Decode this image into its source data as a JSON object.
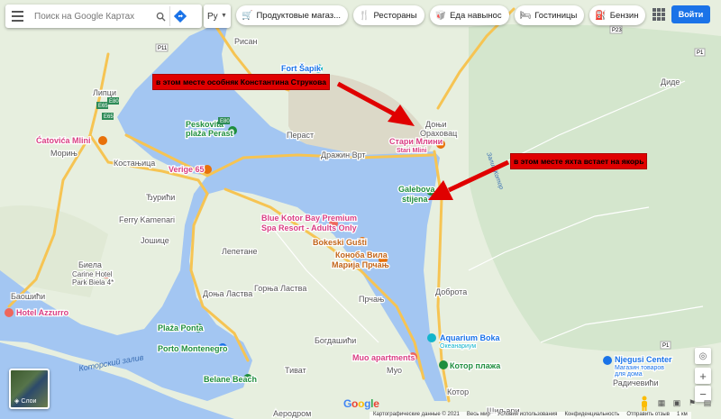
{
  "search": {
    "placeholder": "Поиск на Google Картах",
    "lang_value": "Ру"
  },
  "chips": [
    {
      "icon": "shopping-cart-icon",
      "label": "Продуктовые магаз..."
    },
    {
      "icon": "fork-knife-icon",
      "label": "Рестораны"
    },
    {
      "icon": "takeout-icon",
      "label": "Еда навынос"
    },
    {
      "icon": "bed-icon",
      "label": "Гостиницы"
    },
    {
      "icon": "fuel-pump-icon",
      "label": "Бензин"
    }
  ],
  "header": {
    "signin_label": "Войти"
  },
  "annotations": [
    "в этом месте особняк Константина Струкова",
    "в этом месте яхта встает на якорь"
  ],
  "places": {
    "risan": "Рисан",
    "lipci": "Липци",
    "morinj": "Морињ",
    "kostanjica": "Костањица",
    "djuricici": "Ђурићи",
    "ferry": "Ferry Kamenari",
    "josice": "Јошице",
    "bijela": "Биела",
    "baosici": "Баошићи",
    "perast": "Пераст",
    "dražin": "Дражин Врт",
    "donji": "Доњи",
    "orahovac": "Ораховац",
    "lepetane": "Лепетане",
    "donja_lastva": "Доња Ластва",
    "gornja_lastva": "Горња Ластва",
    "prcanj": "Прчањ",
    "bogdasici": "Богдашићи",
    "tivat": "Тиват",
    "muo": "Муо",
    "dobrota": "Доброта",
    "kotor": "Котор",
    "dide": "Диде",
    "sirokoca": "Шиљари",
    "radicevici": "Радичевићи",
    "aerodrom": "Аеродром",
    "bay": "Которский залив",
    "zaliv": "Залив Котор"
  },
  "pois": {
    "fort": "Fort Šapik",
    "peskovita": "Peskovita\nplaža Perast",
    "catovica": "Ćatovića Mlini",
    "verige": "Verige 65",
    "blue_kotor": "Blue Kotor Bay Premium\nSpa Resort - Adults Only",
    "bokeski": "Bokeski Gušti",
    "konoba": "Конoба Вила\nМарија Прчањ",
    "stari_mlini": "Стари Млини\nStari Mlini",
    "galebova": "Galebova\nstijena",
    "hotel_azzurro": "Hotel Azzurro",
    "carine": "Carine Hotel\nPark Biela 4*",
    "plaza_ponta": "Plaža Ponta",
    "porto": "Porto Montenegro",
    "belane": "Belane Beach",
    "aquarium": "Aquarium Boka",
    "aquarium_sub": "Океанариум",
    "muo_apts": "Muo apartments",
    "kotor_plaza": "Котор плажа",
    "njegusi": "Njegusi Center",
    "njegusi_sub": "Магазин товаров\nдля дома"
  },
  "roads": [
    "P23",
    "P11",
    "E65",
    "E80",
    "E65",
    "E80",
    "P1",
    "P1"
  ],
  "layers_label": "Слои",
  "google_logo": "Google",
  "footer": [
    "Картографические данные © 2021",
    "Весь мир",
    "Условия использования",
    "Конфиденциальность",
    "Отправить отзыв",
    "1 км"
  ],
  "colors": {
    "water": "#a3c6f2",
    "land": "#e8efe0",
    "road": "#f8c967",
    "accent": "#1a73e8",
    "annotation": "#e00000"
  }
}
